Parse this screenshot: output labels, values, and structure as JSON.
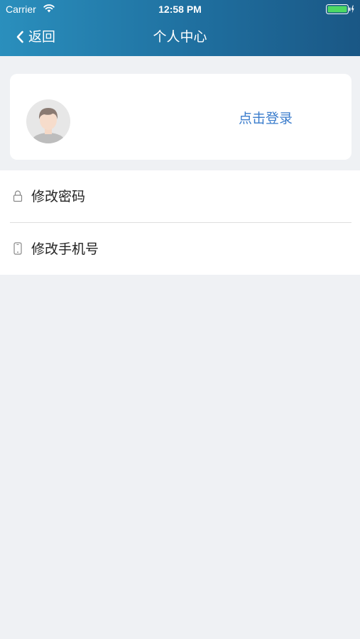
{
  "status_bar": {
    "carrier": "Carrier",
    "time": "12:58 PM"
  },
  "nav": {
    "back_label": "返回",
    "title": "个人中心"
  },
  "login_card": {
    "login_label": "点击登录"
  },
  "menu": {
    "items": [
      {
        "label": "修改密码",
        "icon": "lock-icon"
      },
      {
        "label": "修改手机号",
        "icon": "phone-icon"
      }
    ]
  },
  "colors": {
    "header_start": "#2a8fbd",
    "header_end": "#1a5785",
    "accent": "#3a7ccc",
    "background": "#eff1f4",
    "battery": "#4cd964"
  }
}
